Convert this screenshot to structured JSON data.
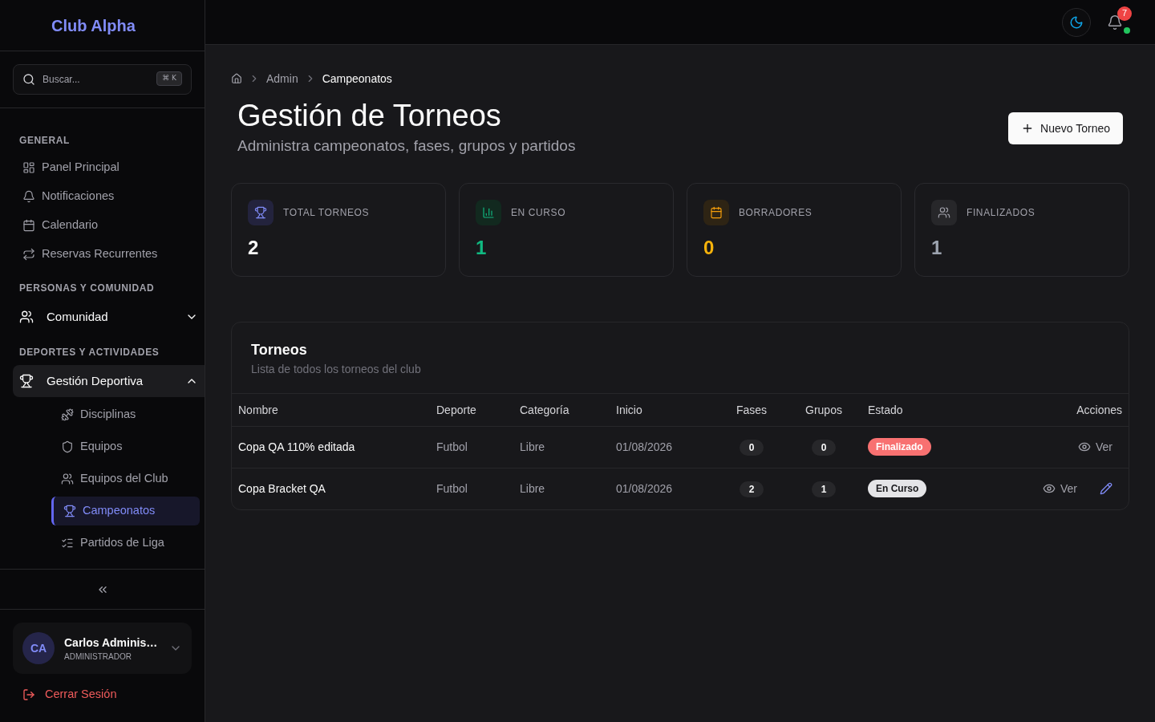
{
  "sidebar": {
    "logo": "Club Alpha",
    "search": {
      "placeholder": "Buscar...",
      "shortcut": "⌘ K"
    },
    "sections": [
      {
        "label": "GENERAL",
        "items": [
          {
            "kind": "link",
            "label": "Panel Principal",
            "selected": false
          },
          {
            "kind": "link",
            "label": "Notificaciones",
            "selected": false
          },
          {
            "kind": "link",
            "label": "Calendario",
            "selected": false
          },
          {
            "kind": "link",
            "label": "Reservas Recurrentes",
            "selected": false
          }
        ]
      },
      {
        "label": "PERSONAS Y COMUNIDAD",
        "items": [
          {
            "kind": "group",
            "label": "Comunidad",
            "selected": false,
            "expanded": false
          }
        ]
      },
      {
        "label": "DEPORTES Y ACTIVIDADES",
        "items": [
          {
            "kind": "group",
            "label": "Gestión Deportiva",
            "selected": false,
            "expanded": true,
            "children": [
              {
                "label": "Disciplinas",
                "selected": false
              },
              {
                "label": "Equipos",
                "selected": false
              },
              {
                "label": "Equipos del Club",
                "selected": false
              },
              {
                "label": "Campeonatos",
                "selected": true
              },
              {
                "label": "Partidos de Liga",
                "selected": false
              }
            ]
          }
        ]
      }
    ],
    "user": {
      "initials": "CA",
      "name": "Carlos Adminis…",
      "role": "ADMINISTRADOR"
    },
    "logout": "Cerrar Sesión"
  },
  "topbar": {
    "notifications": {
      "count": "7",
      "online": true
    }
  },
  "breadcrumb": [
    {
      "label": "Admin",
      "selected": false
    },
    {
      "label": "Campeonatos",
      "selected": true
    }
  ],
  "header": {
    "title": "Gestión de Torneos",
    "subtitle": "Administra campeonatos, fases, grupos y partidos",
    "primary_button": "Nuevo Torneo"
  },
  "stats": [
    {
      "kind": "total",
      "label": "TOTAL TORNEOS",
      "value": "2"
    },
    {
      "kind": "active",
      "label": "EN CURSO",
      "value": "1"
    },
    {
      "kind": "draft",
      "label": "BORRADORES",
      "value": "0"
    },
    {
      "kind": "finished",
      "label": "FINALIZADOS",
      "value": "1"
    }
  ],
  "table": {
    "title": "Torneos",
    "subtitle": "Lista de todos los torneos del club",
    "columns": [
      "Nombre",
      "Deporte",
      "Categoría",
      "Inicio",
      "Fases",
      "Grupos",
      "Estado",
      "Acciones"
    ],
    "rows": [
      {
        "name": "Copa QA 110% editada",
        "sport": "Futbol",
        "category": "Libre",
        "start": "01/08/2026",
        "phases": "0",
        "groups": "0",
        "status": {
          "kind": "finished",
          "label": "Finalizado"
        },
        "actions": [
          {
            "kind": "view",
            "label": "Ver"
          }
        ]
      },
      {
        "name": "Copa Bracket QA",
        "sport": "Futbol",
        "category": "Libre",
        "start": "01/08/2026",
        "phases": "2",
        "groups": "1",
        "status": {
          "kind": "in_progress",
          "label": "En Curso"
        },
        "actions": [
          {
            "kind": "view",
            "label": "Ver"
          },
          {
            "kind": "edit"
          }
        ]
      }
    ]
  }
}
